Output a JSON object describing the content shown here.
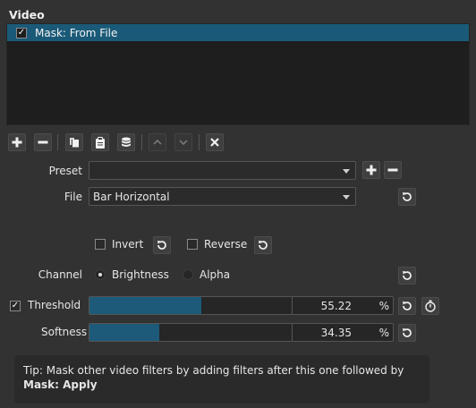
{
  "panel": {
    "title": "Video"
  },
  "filters": [
    {
      "label": "Mask: From File",
      "checked": true,
      "check_glyph": "✓"
    }
  ],
  "toolbar": [
    {
      "name": "add-filter-button",
      "icon": "plus-icon",
      "enabled": true
    },
    {
      "name": "remove-filter-button",
      "icon": "minus-icon",
      "enabled": true
    },
    {
      "name": "copy-filter-button",
      "icon": "copy-icon",
      "enabled": true
    },
    {
      "name": "paste-filter-button",
      "icon": "clipboard-icon",
      "enabled": true
    },
    {
      "name": "save-filter-set-button",
      "icon": "stack-icon",
      "enabled": true
    },
    {
      "name": "move-up-button",
      "icon": "chevron-up-icon",
      "enabled": false
    },
    {
      "name": "move-down-button",
      "icon": "chevron-down-icon",
      "enabled": false
    },
    {
      "name": "deselect-filter-button",
      "icon": "close-icon",
      "enabled": true
    }
  ],
  "preset": {
    "label": "Preset",
    "value": ""
  },
  "file": {
    "label": "File",
    "value": "Bar Horizontal"
  },
  "invert": {
    "label": "Invert",
    "checked": false
  },
  "reverse": {
    "label": "Reverse",
    "checked": false
  },
  "channel": {
    "label": "Channel",
    "options": [
      {
        "label": "Brightness",
        "selected": true
      },
      {
        "label": "Alpha",
        "selected": false
      }
    ]
  },
  "threshold": {
    "label": "Threshold",
    "checked": true,
    "check_glyph": "✓",
    "value": "55.22",
    "unit": "%",
    "fraction": 0.5522
  },
  "softness": {
    "label": "Softness",
    "value": "34.35",
    "unit": "%",
    "fraction": 0.3435
  },
  "tip": {
    "prefix": "Tip: Mask other video filters by adding filters after this one followed by ",
    "bold": "Mask: Apply"
  },
  "colors": {
    "accent": "#1a5a78",
    "background": "#323232",
    "list_bg": "#1e1e1e",
    "slider_fill": "#1d5a7a"
  }
}
